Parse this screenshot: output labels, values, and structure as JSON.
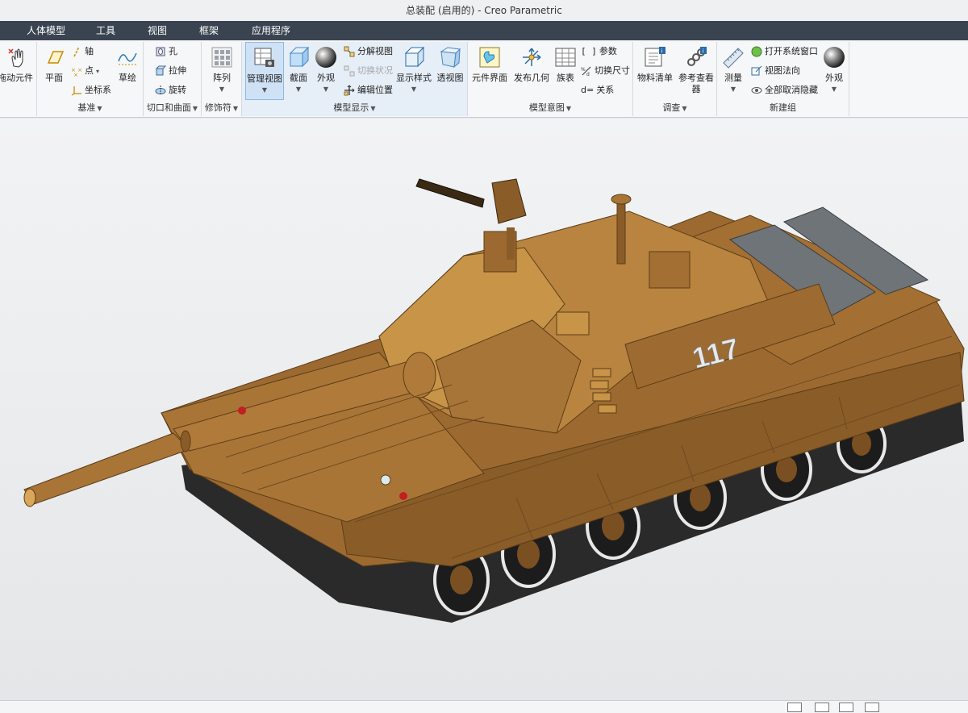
{
  "window": {
    "title": "总装配 (启用的) - Creo Parametric"
  },
  "menu": {
    "tabs": [
      "人体模型",
      "工具",
      "视图",
      "框架",
      "应用程序"
    ]
  },
  "ribbon": {
    "operations": {
      "drag_components": "拖动元件"
    },
    "datum": {
      "label": "基准",
      "plane": "平面",
      "axis": "轴",
      "point": "点",
      "coord_sys": "坐标系",
      "sketch": "草绘"
    },
    "cut_surface": {
      "label": "切口和曲面",
      "hole": "孔",
      "extrude": "拉伸",
      "revolve": "旋转"
    },
    "modifiers": {
      "label": "修饰符",
      "pattern": "阵列"
    },
    "model_display": {
      "label": "模型显示",
      "manage_views": "管理视图",
      "section": "截面",
      "appearance": "外观",
      "exploded_view": "分解视图",
      "toggle_status": "切换状况",
      "edit_position": "编辑位置",
      "display_style": "显示样式",
      "perspective": "透视图"
    },
    "model_intent": {
      "label": "模型意图",
      "component_interface": "元件界面",
      "publish_geometry": "发布几何",
      "family_table": "族表",
      "parameters": "参数",
      "switch_dimensions": "切换尺寸",
      "relations": "关系"
    },
    "investigate": {
      "label": "调查",
      "bom": "物料清单",
      "reference_viewer": "参考查看器"
    },
    "new_group": {
      "label": "新建组",
      "measure": "测量",
      "open_system_window": "打开系统窗口",
      "view_normal": "视图法向",
      "unhide_all": "全部取消隐藏",
      "appearance": "外观"
    }
  },
  "model": {
    "hull_number": "117"
  },
  "colors": {
    "menubar": "#3a4451",
    "tank_body": "#9c6a30",
    "tank_shadow": "#6e4a20",
    "tank_highlight": "#b9843f",
    "track": "#2a2a2a"
  }
}
